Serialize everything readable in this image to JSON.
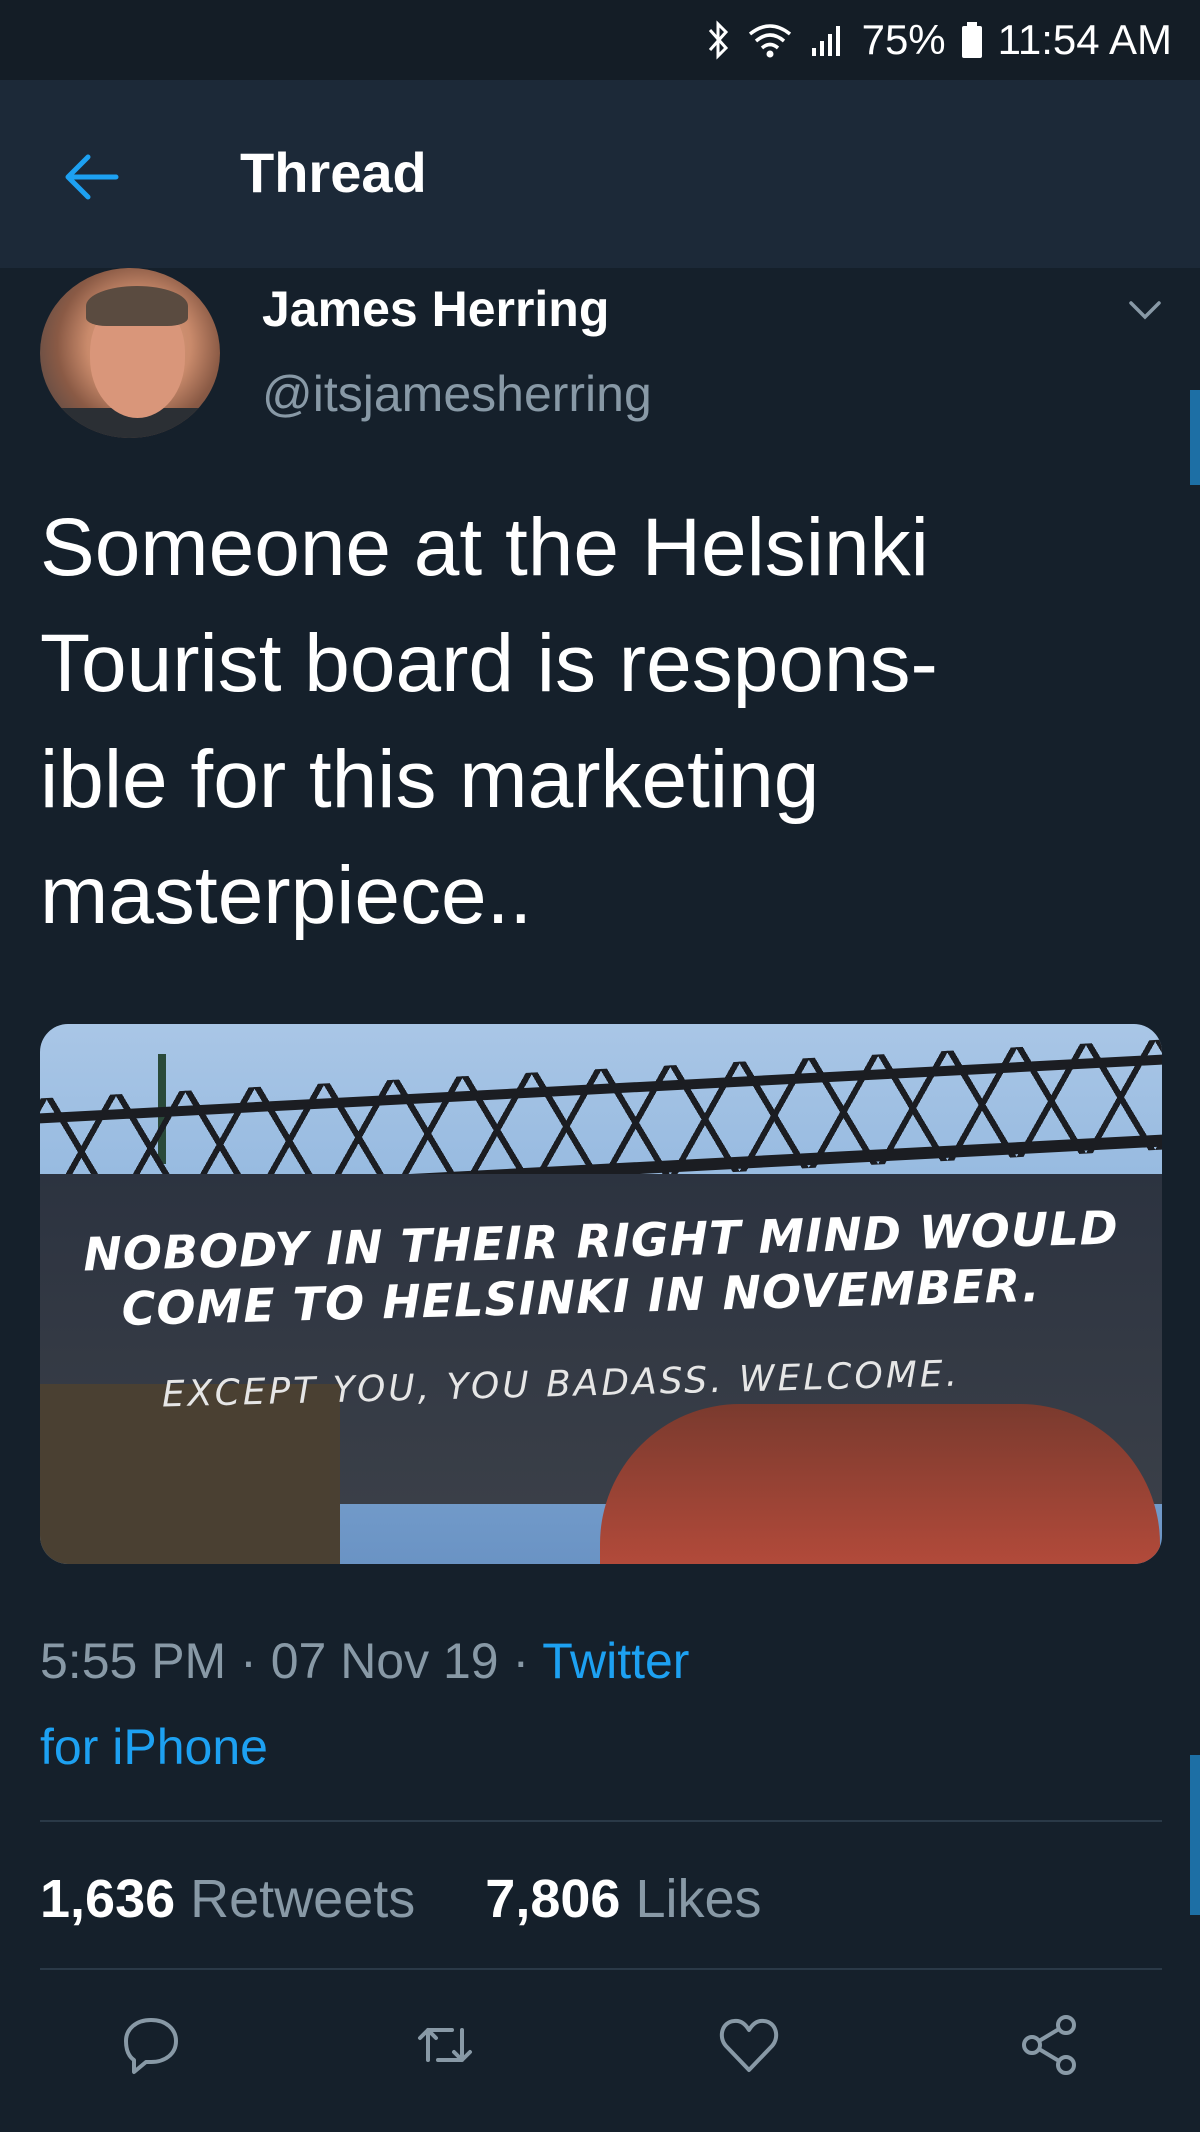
{
  "status_bar": {
    "battery": "75%",
    "time": "11:54 AM",
    "icons": [
      "bluetooth-icon",
      "wifi-icon",
      "signal-icon",
      "battery-icon"
    ]
  },
  "header": {
    "title": "Thread",
    "back_icon": "arrow-left-icon"
  },
  "tweet": {
    "author_name": "James Herring",
    "author_handle": "@itsjamesherring",
    "text": "Someone at the Helsinki Tourist board is respons-ible for this marketing masterpiece..",
    "text_lines": [
      "Someone at the Helsinki",
      "Tourist board is respons-",
      "ible for this marketing",
      "masterpiece.."
    ],
    "image": {
      "line1": "NOBODY IN THEIR RIGHT MIND WOULD",
      "line2": "COME TO HELSINKI IN NOVEMBER.",
      "line3": "EXCEPT YOU, YOU BADASS. WELCOME."
    },
    "time": "5:55 PM",
    "separator": "·",
    "date": "07 Nov 19",
    "source_line1": "Twitter",
    "source_line2": "for iPhone"
  },
  "stats": {
    "retweets_count": "1,636",
    "retweets_label": "Retweets",
    "likes_count": "7,806",
    "likes_label": "Likes"
  },
  "actions": [
    "reply-icon",
    "retweet-icon",
    "like-icon",
    "share-icon"
  ],
  "colors": {
    "background": "#15202b",
    "header": "#1c2938",
    "accent": "#1da1f2",
    "secondary_text": "#8899a6"
  }
}
